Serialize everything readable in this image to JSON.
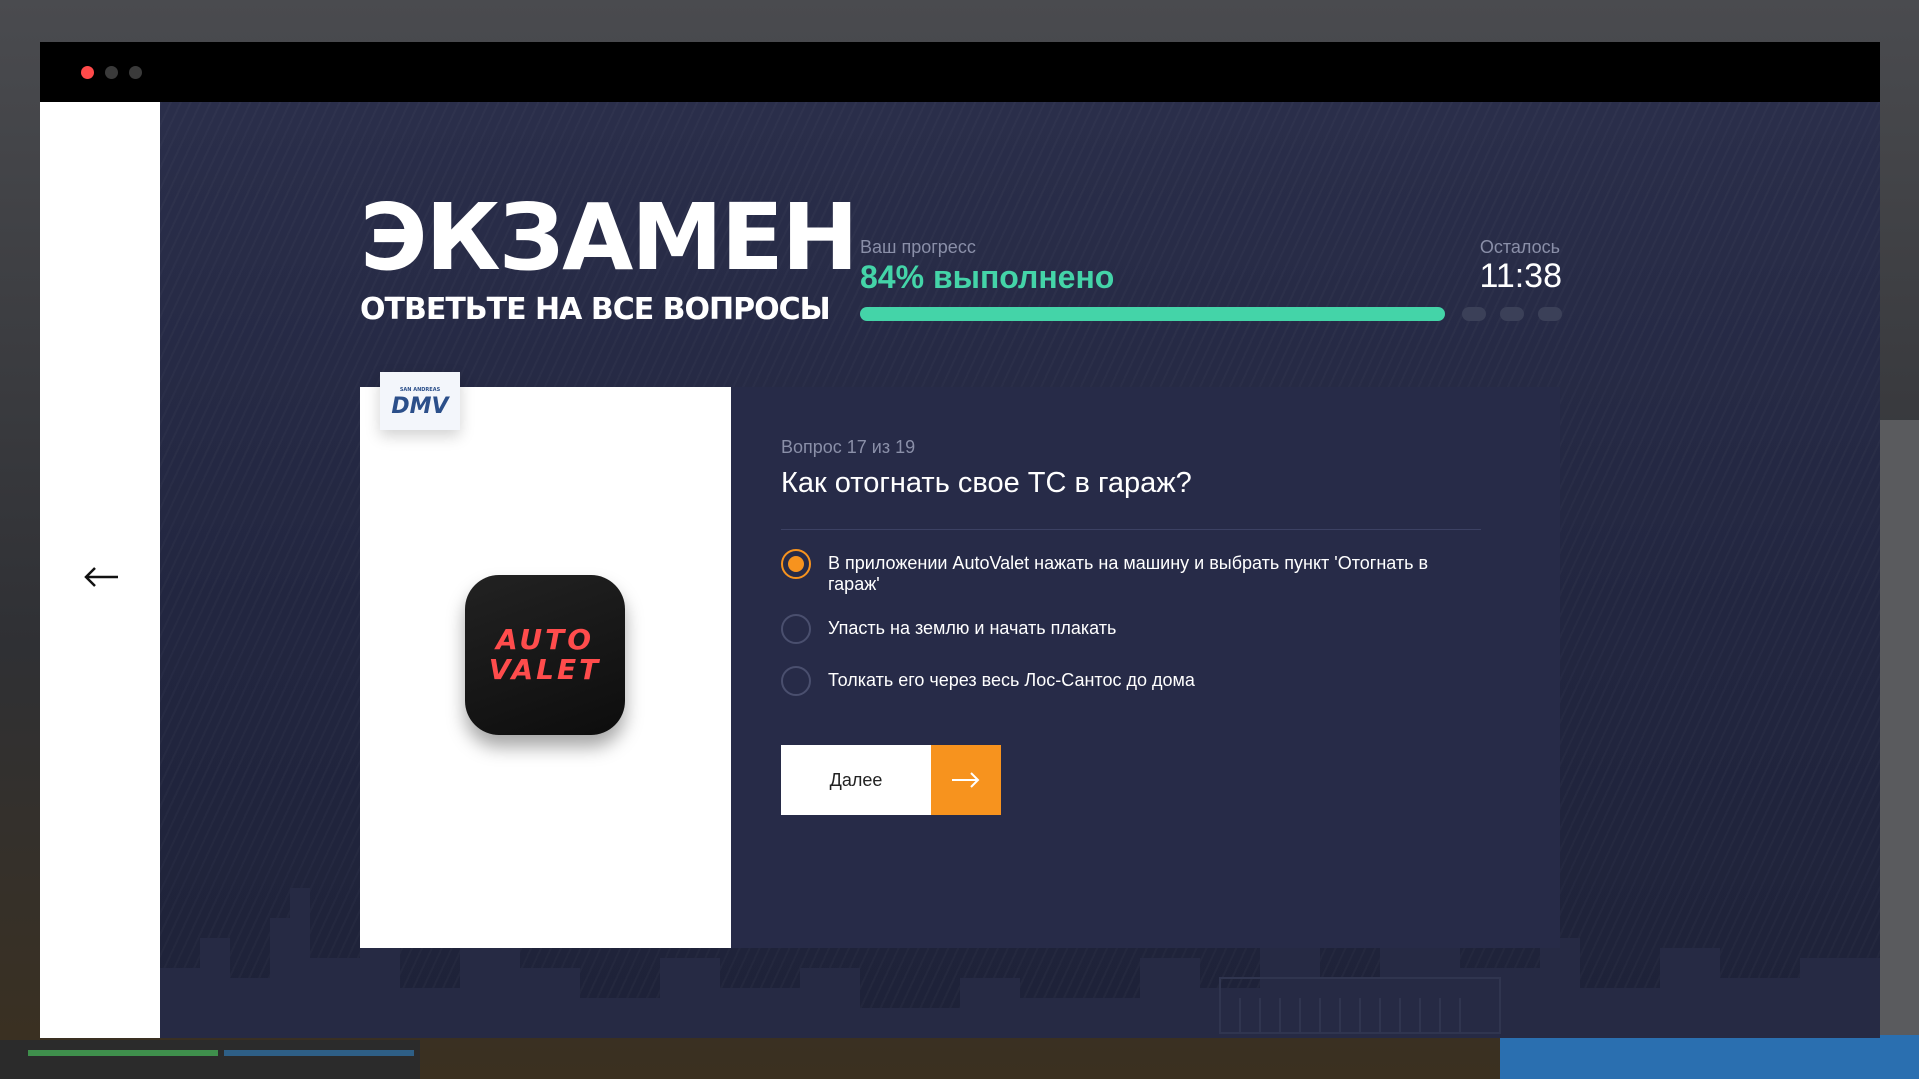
{
  "header": {
    "title": "ЭКЗАМЕН",
    "subtitle": "ОТВЕТЬТЕ НА ВСЕ ВОПРОСЫ"
  },
  "progress": {
    "label": "Ваш прогресс",
    "value_text": "84% выполнено",
    "fraction": 0.84
  },
  "timer": {
    "label": "Осталось",
    "value": "11:38"
  },
  "question": {
    "counter": "Вопрос 17 из 19",
    "text": "Как отогнать свое ТС в гараж?",
    "answers": [
      {
        "text": "В приложении AutoValet нажать на машину и выбрать пункт 'Отогнать в гараж'",
        "selected": true
      },
      {
        "text": "Упасть на землю и начать плакать",
        "selected": false
      },
      {
        "text": "Толкать его через весь Лос-Сантос до дома",
        "selected": false
      }
    ]
  },
  "image_panel": {
    "badge_small_text": "SAN ANDREAS",
    "badge_text": "DMV",
    "app_icon_line1": "AUTO",
    "app_icon_line2": "VALET"
  },
  "next_button": {
    "label": "Далее"
  },
  "colors": {
    "accent_green": "#44d4a8",
    "accent_orange": "#f7931e",
    "panel_dark": "#272b48",
    "background": "#222640"
  },
  "icons": {
    "back": "arrow-left-icon",
    "next": "arrow-right-icon"
  }
}
